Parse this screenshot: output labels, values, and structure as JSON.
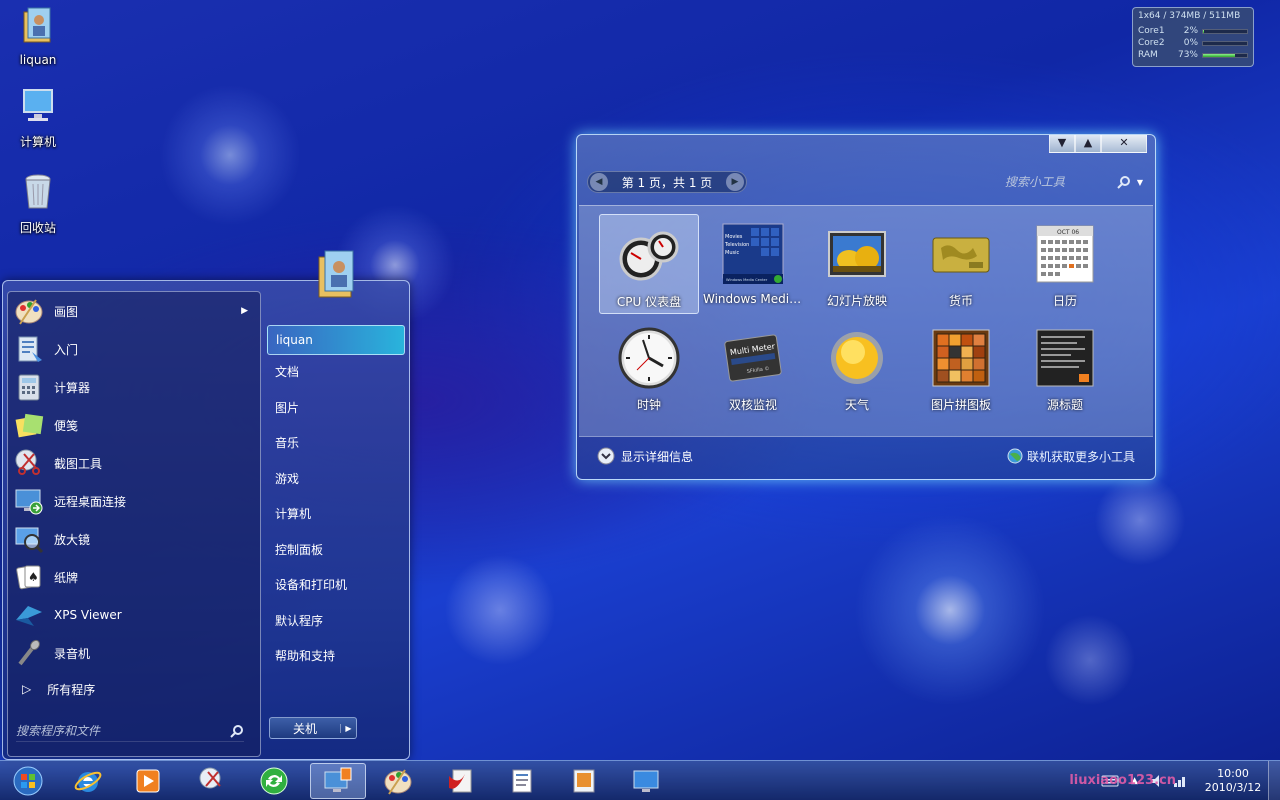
{
  "desktop": {
    "icons": [
      {
        "label": "liquan",
        "icon": "user-folder-icon"
      },
      {
        "label": "计算机",
        "icon": "computer-icon"
      },
      {
        "label": "回收站",
        "icon": "recycle-bin-icon"
      }
    ]
  },
  "meter": {
    "header": "1x64 / 374MB / 511MB",
    "rows": [
      {
        "label": "Core1",
        "value": "2%",
        "level": 0.02
      },
      {
        "label": "Core2",
        "value": "0%",
        "level": 0.0
      },
      {
        "label": "RAM",
        "value": "73%",
        "level": 0.73
      }
    ]
  },
  "gadgets": {
    "controls": {
      "collapse": "▼",
      "expand": "▲",
      "close": "✕"
    },
    "pager_text": "第 1 页，共 1 页",
    "search_placeholder": "搜索小工具",
    "items": [
      {
        "label": "CPU 仪表盘",
        "icon": "cpu-meter-icon",
        "selected": true
      },
      {
        "label": "Windows Media...",
        "icon": "windows-media-center-icon"
      },
      {
        "label": "幻灯片放映",
        "icon": "slideshow-icon"
      },
      {
        "label": "货币",
        "icon": "currency-icon"
      },
      {
        "label": "日历",
        "icon": "calendar-icon"
      },
      {
        "label": "时钟",
        "icon": "clock-icon"
      },
      {
        "label": "双核监视",
        "icon": "multi-meter-icon"
      },
      {
        "label": "天气",
        "icon": "weather-sun-icon"
      },
      {
        "label": "图片拼图板",
        "icon": "picture-puzzle-icon"
      },
      {
        "label": "源标题",
        "icon": "feed-headlines-icon"
      }
    ],
    "details_label": "显示详细信息",
    "more_label": "联机获取更多小工具",
    "media_center_lines": [
      "Movies",
      "Television",
      "Music"
    ],
    "media_center_caption": "Windows Media Center",
    "calendar_month": "OCT 06",
    "multimeter_title": "Multi Meter",
    "multimeter_brand": "SFkilla ©"
  },
  "start_menu": {
    "programs": [
      {
        "label": "画图",
        "icon": "paint-icon",
        "has_submenu": true
      },
      {
        "label": "入门",
        "icon": "getting-started-icon"
      },
      {
        "label": "计算器",
        "icon": "calculator-icon"
      },
      {
        "label": "便笺",
        "icon": "sticky-notes-icon"
      },
      {
        "label": "截图工具",
        "icon": "snipping-tool-icon"
      },
      {
        "label": "远程桌面连接",
        "icon": "remote-desktop-icon"
      },
      {
        "label": "放大镜",
        "icon": "magnifier-icon"
      },
      {
        "label": "纸牌",
        "icon": "solitaire-icon"
      },
      {
        "label": "XPS Viewer",
        "icon": "xps-viewer-icon"
      },
      {
        "label": "录音机",
        "icon": "sound-recorder-icon"
      }
    ],
    "all_programs": "所有程序",
    "search_placeholder": "搜索程序和文件",
    "user": "liquan",
    "links": [
      "文档",
      "图片",
      "音乐",
      "游戏",
      "计算机",
      "控制面板",
      "设备和打印机",
      "默认程序",
      "帮助和支持"
    ],
    "shutdown": "关机"
  },
  "taskbar": {
    "buttons": [
      {
        "name": "start-orb",
        "icon": "windows-orb-icon"
      },
      {
        "name": "internet-explorer",
        "icon": "internet-explorer-icon"
      },
      {
        "name": "media-player",
        "icon": "media-player-icon"
      },
      {
        "name": "snipping-tool",
        "icon": "snipping-tool-icon"
      },
      {
        "name": "sync-center",
        "icon": "sync-icon"
      },
      {
        "name": "gadgets",
        "icon": "desktop-gadgets-icon",
        "active": true
      },
      {
        "name": "paint",
        "icon": "paint-icon"
      },
      {
        "name": "pdf",
        "icon": "pdf-icon"
      },
      {
        "name": "document",
        "icon": "document-icon"
      },
      {
        "name": "image-viewer",
        "icon": "image-viewer-icon"
      },
      {
        "name": "monitor",
        "icon": "monitor-icon"
      }
    ],
    "time": "10:00",
    "date": "2010/3/12",
    "watermark": "liuxiaoo123.cn"
  },
  "colors": {
    "accent": "#3ad8f0",
    "glow": "#78dcff",
    "watermark": "#e05ca8"
  }
}
